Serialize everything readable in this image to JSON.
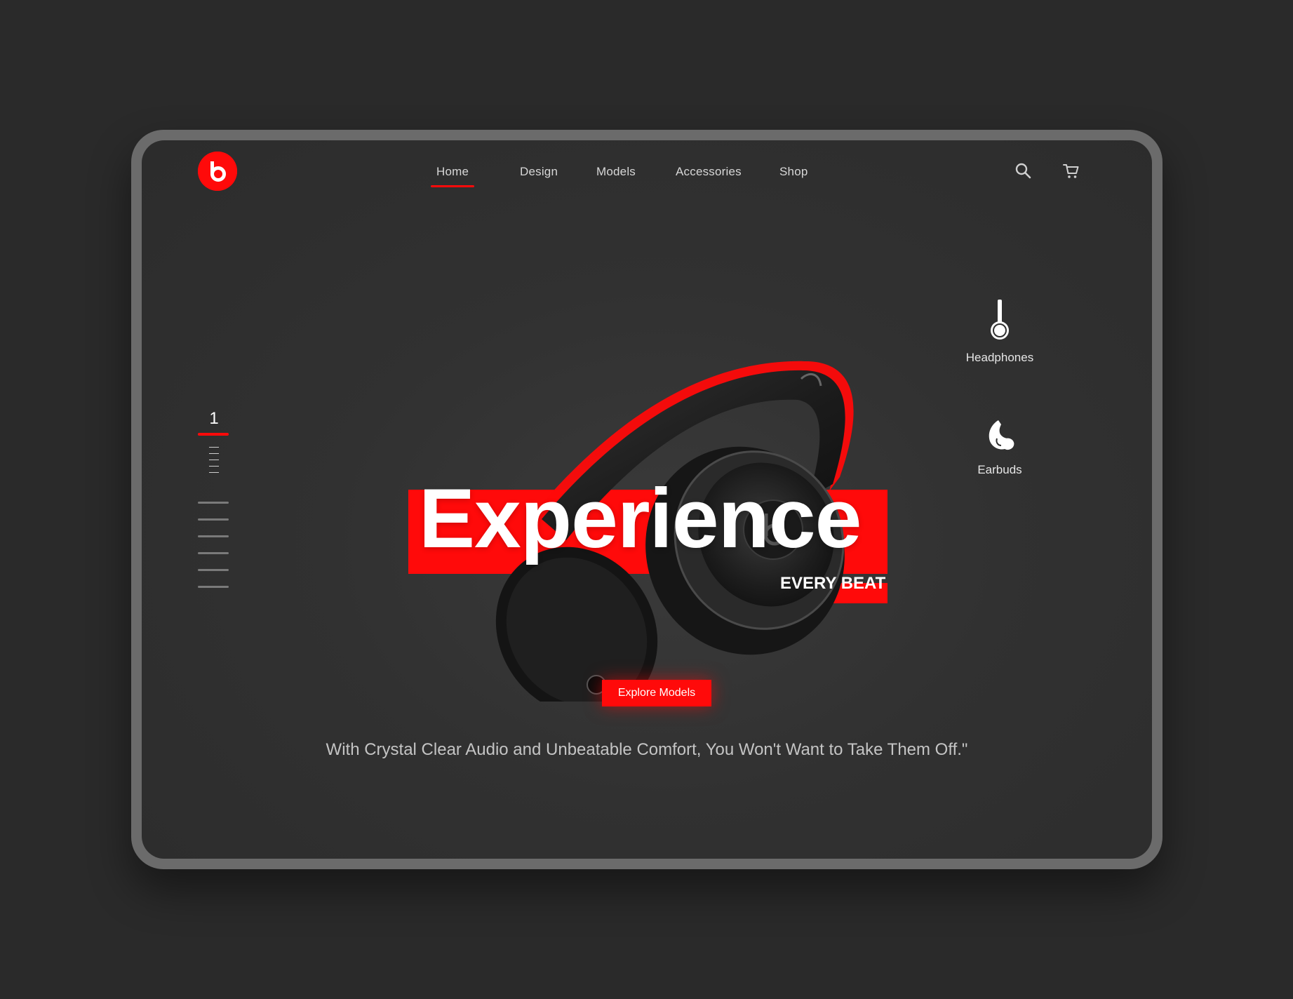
{
  "brand": {
    "logo_letter": "b"
  },
  "nav": {
    "items": [
      {
        "label": "Home",
        "active": true
      },
      {
        "label": "Design",
        "active": false
      },
      {
        "label": "Models",
        "active": false
      },
      {
        "label": "Accessories",
        "active": false
      },
      {
        "label": "Shop",
        "active": false
      }
    ]
  },
  "header_icons": [
    "search-icon",
    "cart-icon"
  ],
  "pager": {
    "current": "1"
  },
  "hero": {
    "title": "Experience",
    "subtitle": "EVERY BEAT",
    "cta_label": "Explore Models",
    "tagline": "With Crystal Clear Audio and Unbeatable Comfort, You Won't Want to Take Them Off.\""
  },
  "categories": [
    {
      "label": "Headphones",
      "icon": "headphones-icon"
    },
    {
      "label": "Earbuds",
      "icon": "earbuds-icon"
    }
  ],
  "colors": {
    "accent": "#ff0a0a",
    "background": "#2a2a2a",
    "screen": "#313131",
    "frame": "#6b6b6b"
  }
}
